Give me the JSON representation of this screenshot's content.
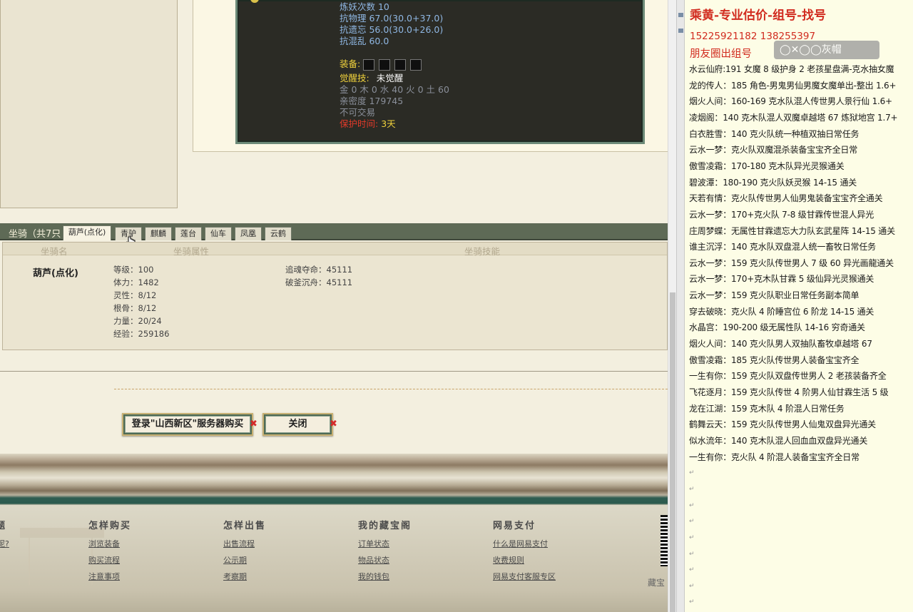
{
  "tooltip": {
    "lines": [
      {
        "text": "炼妖次数 10"
      },
      {
        "text": "抗物理 67.0(30.0+37.0)"
      },
      {
        "text": "抗遗忘 56.0(30.0+26.0)"
      },
      {
        "text": "抗混乱 60.0"
      },
      {
        "text": "装备:"
      },
      {
        "text": "觉醒技:"
      },
      {
        "text": "未觉醒"
      },
      {
        "text": "金 0 木 0 水 40 火 0 土 60"
      },
      {
        "text": "亲密度 179745"
      },
      {
        "text": "不可交易"
      },
      {
        "text": "保护时间:"
      },
      {
        "text": "3天"
      }
    ]
  },
  "mount": {
    "section_title": "坐骑（共7只",
    "tabs": [
      "葫芦(点化)",
      "青驴",
      "麒麟",
      "莲台",
      "仙车",
      "凤凰",
      "云鹤"
    ],
    "active_tab": "葫芦(点化)",
    "headers": [
      "坐骑名",
      "坐骑属性",
      "坐骑技能"
    ],
    "name": "葫芦(点化)",
    "attributes": [
      "等级：100",
      "体力：1482",
      "灵性：8/12",
      "根骨：8/12",
      "力量：20/24",
      "经验：259186"
    ],
    "skills": [
      "追魂夺命：45111",
      "破釜沉舟：45111"
    ]
  },
  "buttons": {
    "login": "登录\"山西新区\"服务器购买",
    "close": "关闭",
    "x_mark": "✖"
  },
  "footer": {
    "columns": [
      {
        "title": "怎样购买",
        "links": [
          "浏览装备",
          "购买流程",
          "注意事项"
        ]
      },
      {
        "title": "怎样出售",
        "links": [
          "出售流程",
          "公示期",
          "考察期"
        ]
      },
      {
        "title": "我的藏宝阁",
        "links": [
          "订单状态",
          "物品状态",
          "我的钱包"
        ]
      },
      {
        "title": "网易支付",
        "links": [
          "什么是网易支付",
          "收费规则",
          "网易支付客服专区"
        ]
      }
    ],
    "left_cut_title": "题",
    "left_cut_link": "呢?",
    "right_cut": "藏宝"
  },
  "notes": {
    "heading": "乘黄-专业估价-组号-找号",
    "phones": "15225921182    1‍3‍8255397",
    "moments": "朋友圈出组号",
    "watermark": "◯✕◯◯灰帽",
    "para_mark": "↵",
    "entries": [
      "水云仙府:191 女魔 8 级护身 2 老孩星盘满-克水抽女魔",
      "龙的传人：185 角色-男鬼男仙男魔女魔单出-整出 1.6+",
      "烟火人间：160-169 克水队混人传世男人景行仙 1.6+",
      "凌烟阁：140 克木队混人双魔卓越塔 67 炼狱地宫 1.7+",
      "白衣胜雪：140 克火队统一种植双抽日常任务",
      "云水一梦：克火队双魔混杀装备宝宝齐全日常",
      "傲雪凌霜：170-180 克木队异光灵猴通关",
      "碧波潭：180-190 克火队妖灵猴 14-15 通关",
      "天若有情：克火队传世男人仙男鬼装备宝宝齐全通关",
      "云水一梦：170+克火队 7-8 级甘霖传世混人异光",
      "庄周梦蝶：无属性甘霖遗忘大力队玄武星阵 14-15 通关",
      "谁主沉浮：140 克水队双盘混人统一畜牧日常任务",
      "云水一梦：159 克火队传世男人 7 级 60 异光画龍通关",
      "云水一梦：170+克木队甘霖 5 级仙异光灵猴通关",
      "云水一梦：159 克火队职业日常任务副本简单",
      "穿去破晓：克火队 4 阶睡宫位 6 阶龙 14-15 通关",
      "水晶宫：190-200 级无属性队 14-16 穷奇通关",
      "烟火人间：140 克火队男人双抽队畜牧卓越塔 67",
      "傲雪凌霜：185 克火队传世男人装备宝宝齐全",
      "一生有你：159 克火队双盘传世男人 2 老孩装备齐全",
      "飞花逐月：159 克火队传世 4 阶男人仙甘霖生活 5 级",
      "龙在江湖：159 克木队 4 阶混人日常任务",
      "鹤舞云天：159 克火队传世男人仙鬼双盘异光通关",
      "似水流年：140 克木队混人回血血双盘异光通关",
      "一生有你：克火队 4 阶混人装备宝宝齐全日常"
    ]
  }
}
